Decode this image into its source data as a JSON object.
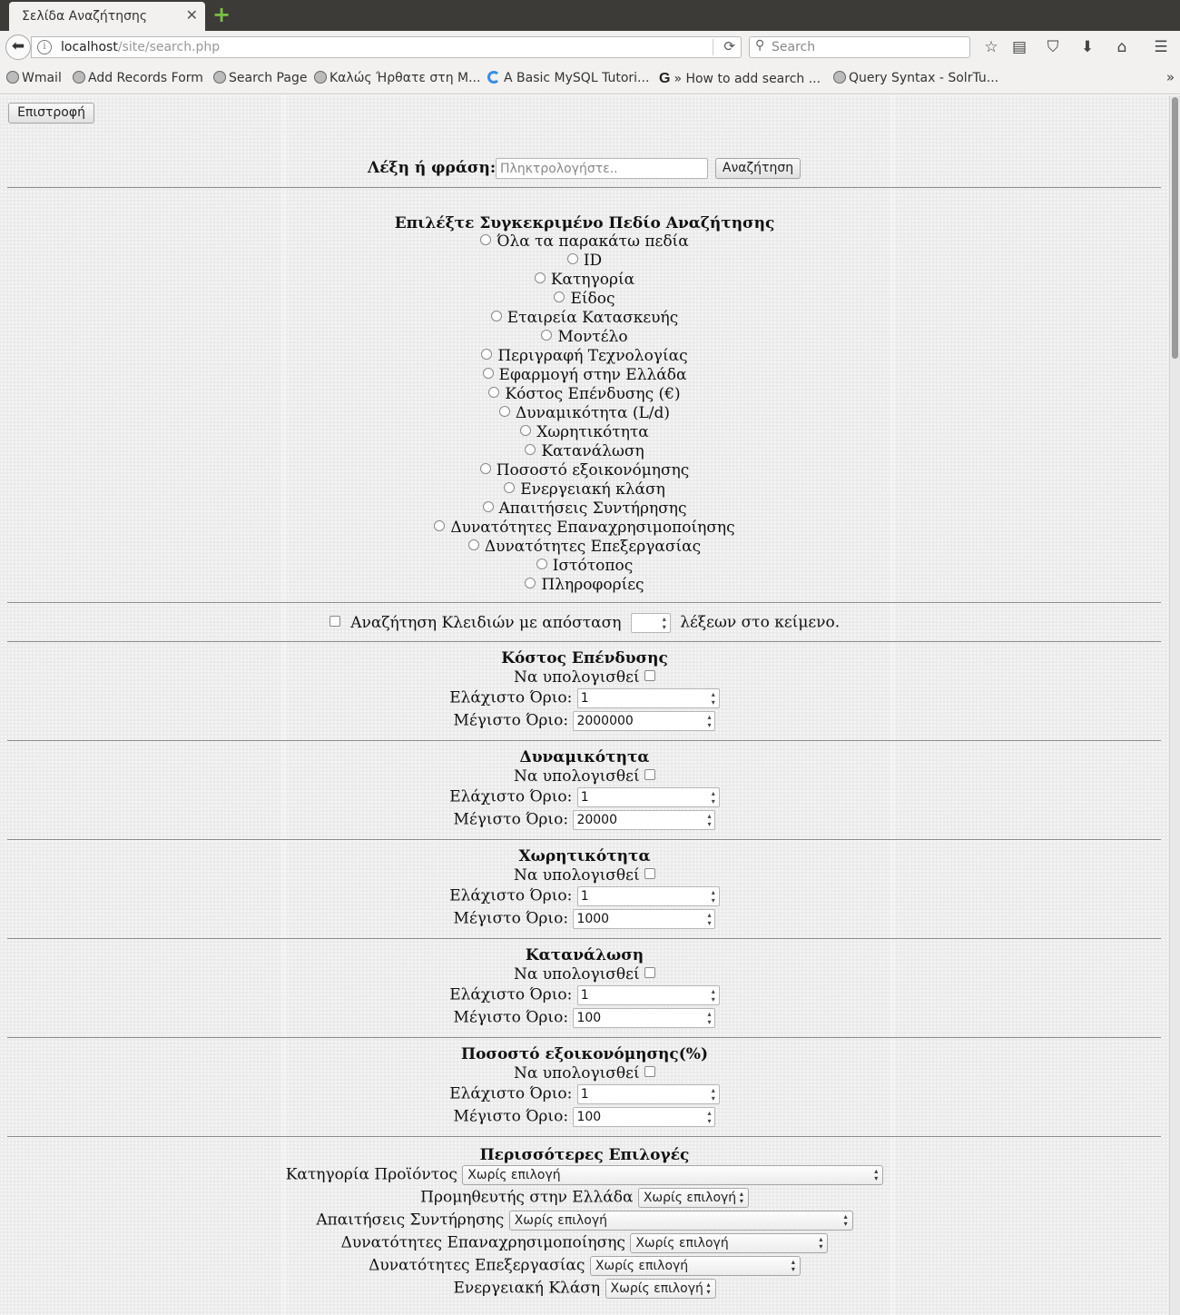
{
  "browser": {
    "tab_title": "Σελίδα Αναζήτησης",
    "url_host": "localhost",
    "url_path": "/site/search.php",
    "search_placeholder": "Search",
    "bookmarks": [
      "Wmail",
      "Add Records Form",
      "Search Page",
      "Καλώς Ήρθατε στη Μ...",
      "A Basic MySQL Tutori...",
      "» How to add search ...",
      "Query Syntax - SolrTu..."
    ]
  },
  "page": {
    "back_button": "Επιστροφή",
    "search": {
      "label": "Λέξη ή φράση:",
      "placeholder": "Πληκτρολογήστε..",
      "button": "Αναζήτηση"
    },
    "fields_heading": "Επιλέξτε Συγκεκριμένο Πεδίο Αναζήτησης",
    "fields": [
      "Όλα τα παρακάτω πεδία",
      "ID",
      "Κατηγορία",
      "Είδος",
      "Εταιρεία Κατασκευής",
      "Μοντέλο",
      "Περιγραφή Τεχνολογίας",
      "Εφαρμογή στην Ελλάδα",
      "Κόστος Επένδυσης (€)",
      "Δυναμικότητα (L/d)",
      "Χωρητικότητα",
      "Κατανάλωση",
      "Ποσοστό εξοικονόμησης",
      "Ενεργειακή κλάση",
      "Απαιτήσεις Συντήρησης",
      "Δυνατότητες Επαναχρησιμοποίησης",
      "Δυνατότητες Επεξεργασίας",
      "Ιστότοπος",
      "Πληροφορίες"
    ],
    "proximity": {
      "label_before": "Αναζήτηση Κλειδιών με απόσταση",
      "label_after": "λέξεων στο κείμενο."
    },
    "range_labels": {
      "compute": "Να υπολογισθεί",
      "min": "Ελάχιστο Όριο:",
      "max": "Μέγιστο Όριο:"
    },
    "ranges": [
      {
        "title": "Κόστος Επένδυσης",
        "min": "1",
        "max": "2000000"
      },
      {
        "title": "Δυναμικότητα",
        "min": "1",
        "max": "20000"
      },
      {
        "title": "Χωρητικότητα",
        "min": "1",
        "max": "1000"
      },
      {
        "title": "Κατανάλωση",
        "min": "1",
        "max": "100"
      },
      {
        "title": "Ποσοστό εξοικονόμησης(%)",
        "min": "1",
        "max": "100"
      }
    ],
    "more_options": {
      "heading": "Περισσότερες Επιλογές",
      "selects": [
        {
          "label": "Κατηγορία Προϊόντος",
          "value": "Χωρίς επιλογή"
        },
        {
          "label": "Προμηθευτής στην Ελλάδα",
          "value": "Χωρίς επιλογή"
        },
        {
          "label": "Απαιτήσεις Συντήρησης",
          "value": "Χωρίς επιλογή"
        },
        {
          "label": "Δυνατότητες Επαναχρησιμοποίησης",
          "value": "Χωρίς επιλογή"
        },
        {
          "label": "Δυνατότητες Επεξεργασίας",
          "value": "Χωρίς επιλογή"
        },
        {
          "label": "Ενεργειακή Κλάση",
          "value": "Χωρίς επιλογή"
        }
      ]
    }
  }
}
